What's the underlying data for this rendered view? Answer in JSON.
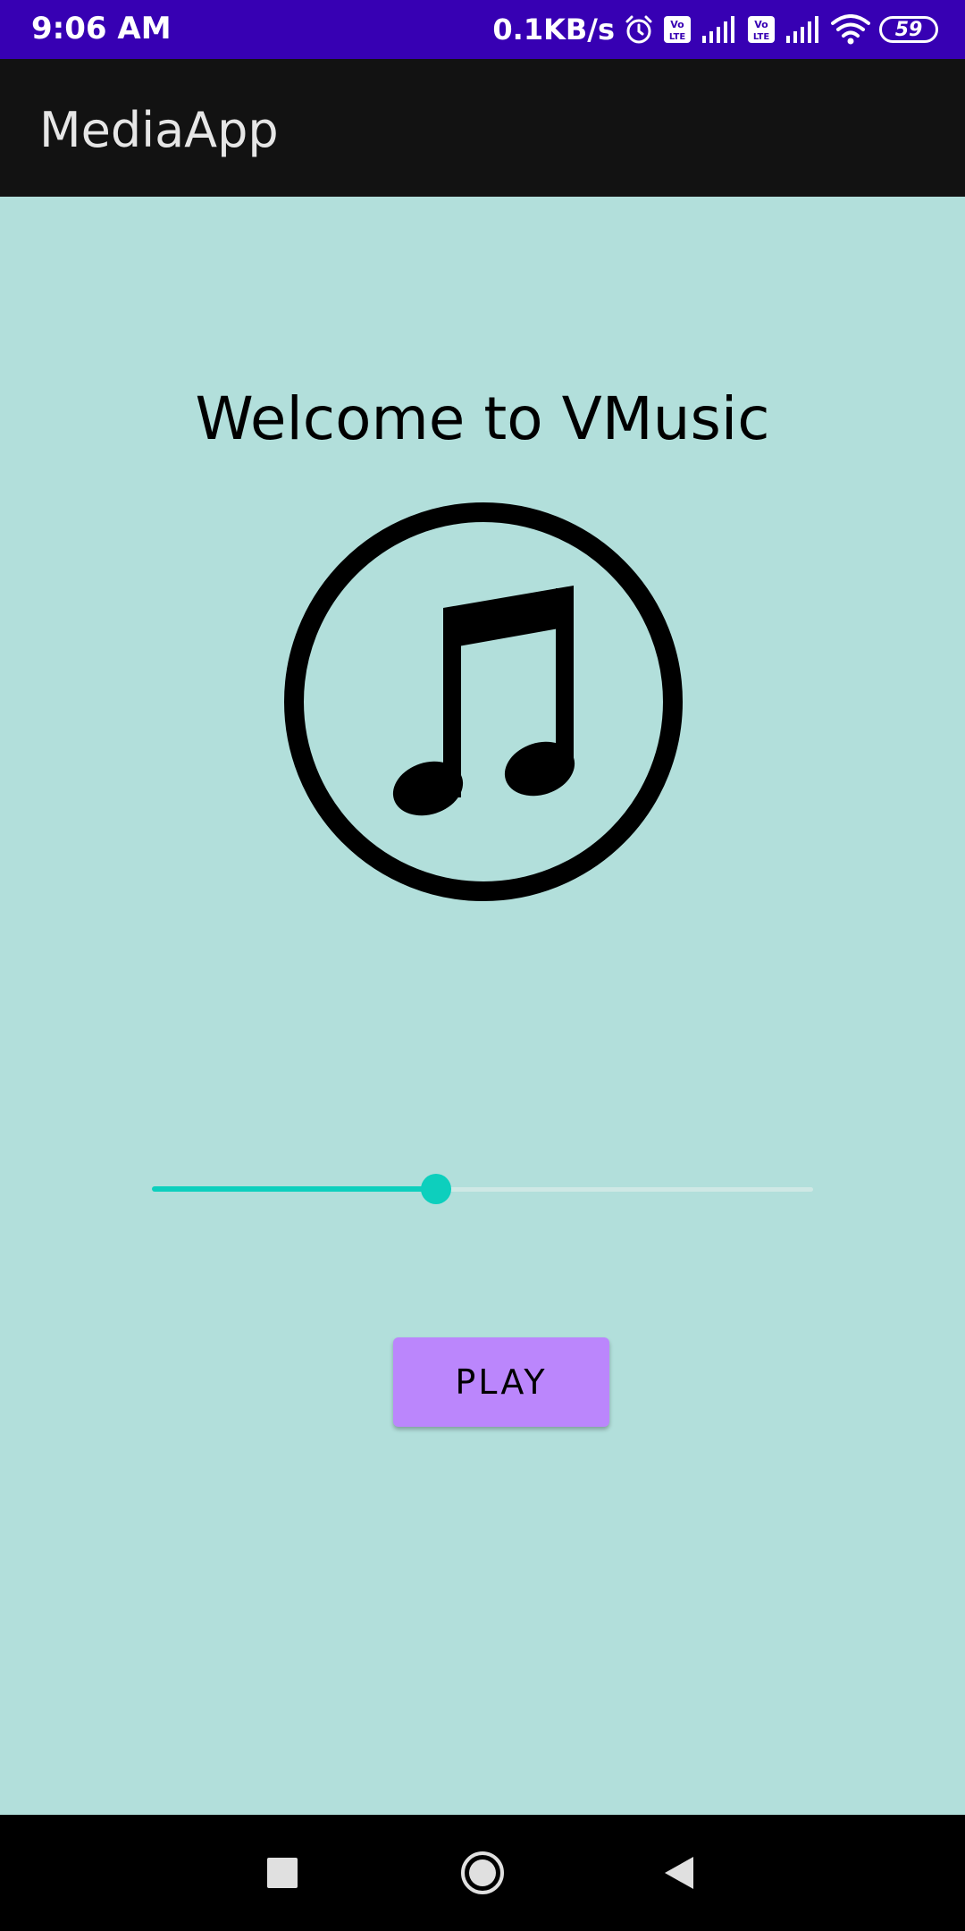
{
  "status_bar": {
    "time": "9:06 AM",
    "net_speed": "0.1KB/s",
    "battery": "59",
    "icons": [
      "alarm-icon",
      "volte-icon",
      "signal-icon",
      "volte-icon",
      "signal-icon",
      "wifi-icon",
      "battery-icon"
    ],
    "background": "#3700b3"
  },
  "app_bar": {
    "title": "MediaApp",
    "background": "#121212"
  },
  "main": {
    "background": "#b2dfdb",
    "welcome_text": "Welcome to VMusic",
    "logo_icon": "music-note-circle-icon",
    "seekbar": {
      "progress_fraction": 0.43,
      "accent": "#0dcfbd"
    },
    "play_button": {
      "label": "PLAY",
      "color": "#bb86fc"
    }
  },
  "nav_bar": {
    "items": [
      "recents-square-icon",
      "home-circle-icon",
      "back-triangle-icon"
    ]
  }
}
